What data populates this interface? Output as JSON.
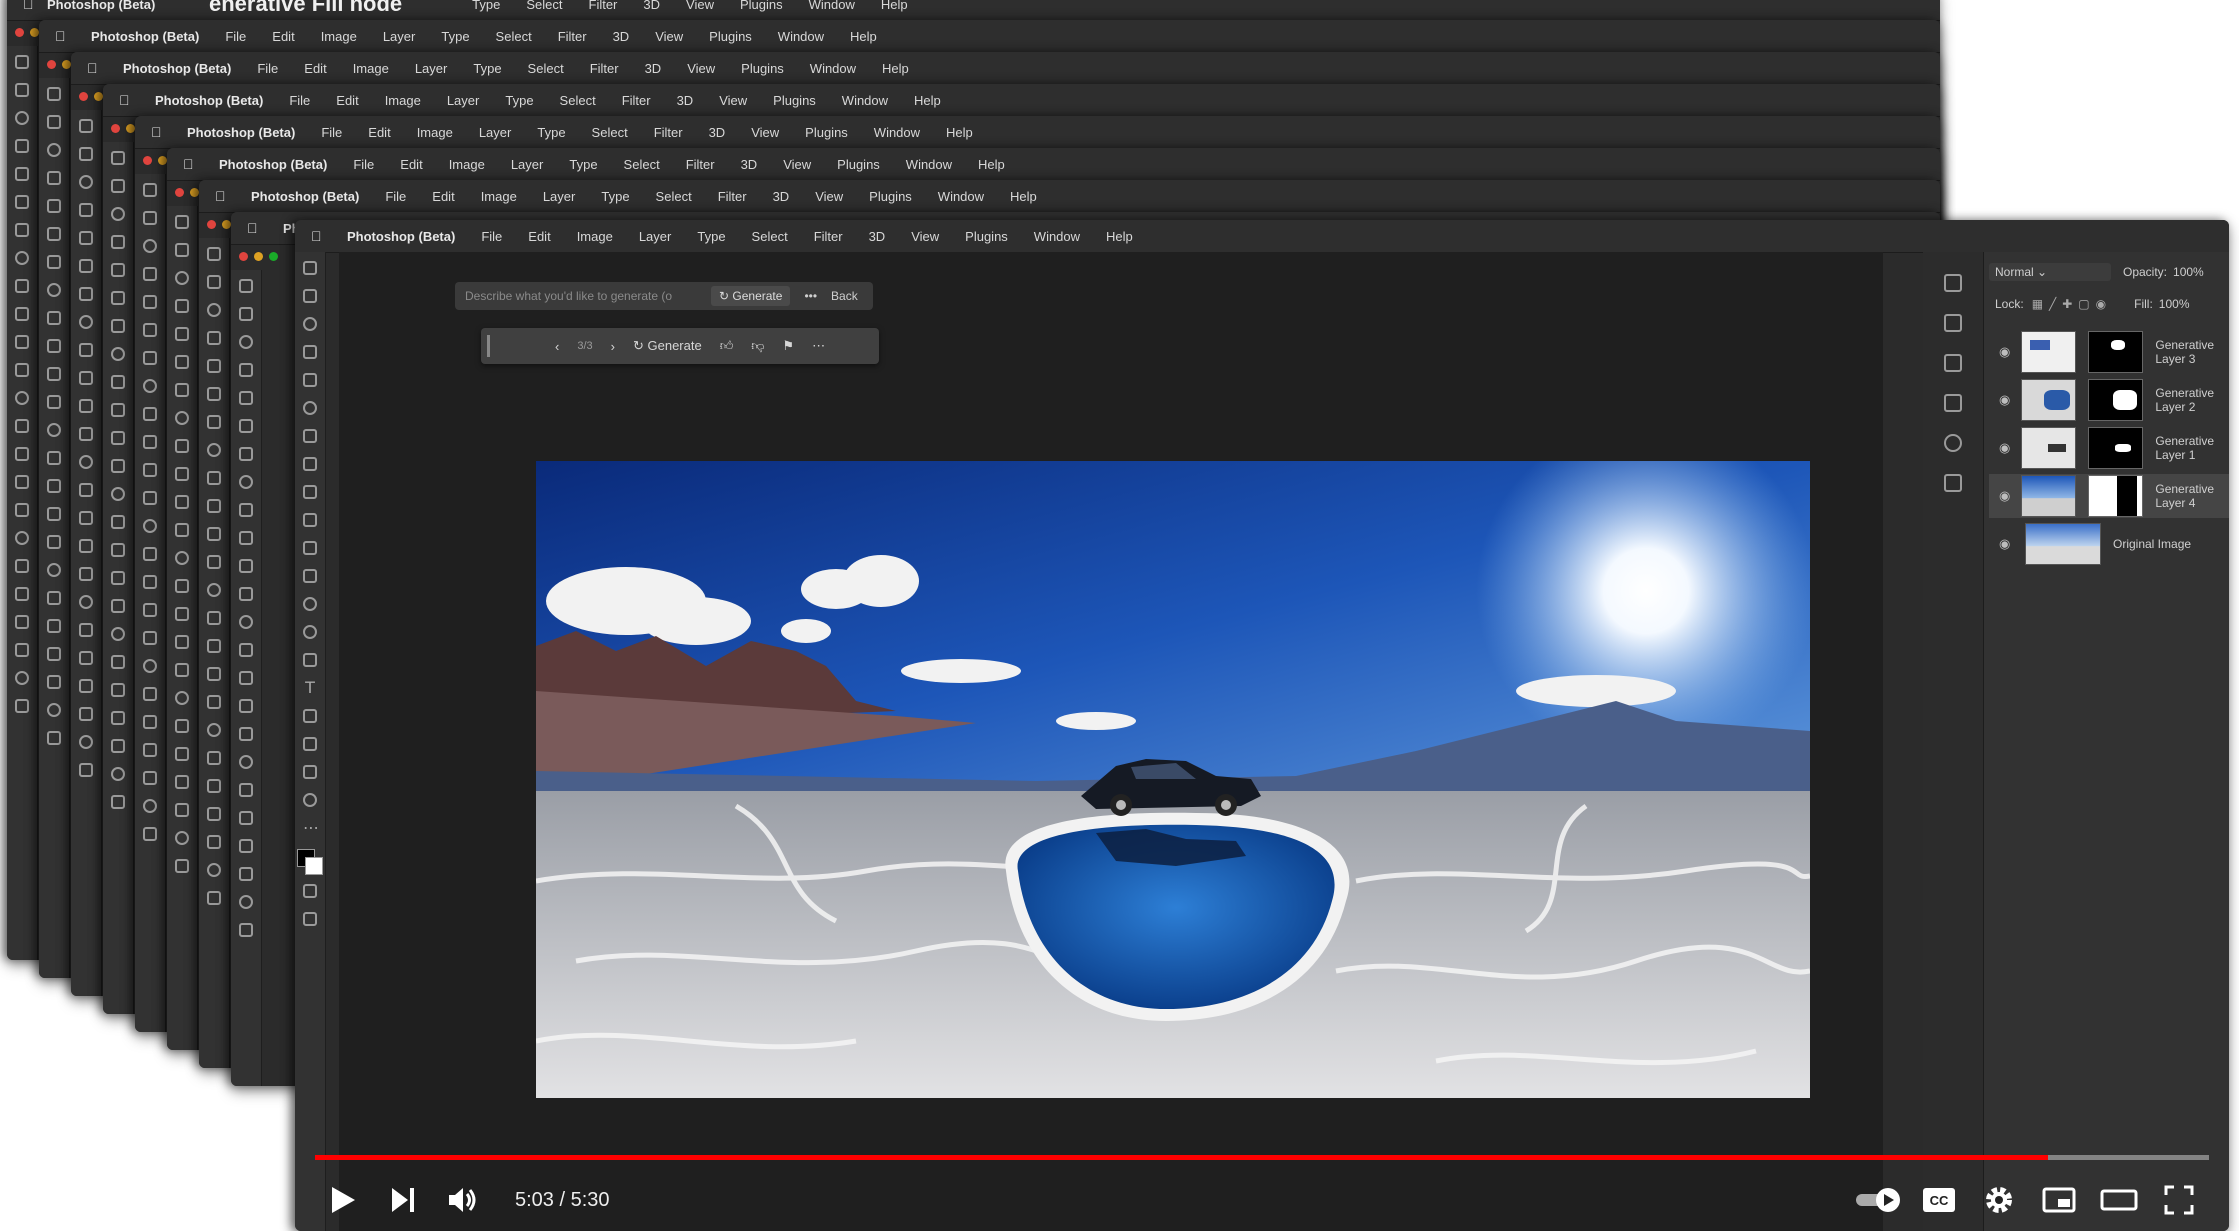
{
  "menubar": {
    "app": "Photoshop (Beta)",
    "items": [
      "File",
      "Edit",
      "Image",
      "Layer",
      "Type",
      "Select",
      "Filter",
      "3D",
      "View",
      "Plugins",
      "Window",
      "Help"
    ],
    "top_partial_items": [
      "Type",
      "Select",
      "Filter",
      "3D",
      "View",
      "Plugins",
      "Window",
      "Help"
    ]
  },
  "overlay_title": "enerative Fill node",
  "options_bar": {
    "placeholder": "Describe what you'd like to generate (o",
    "generate_label": "Generate",
    "more_label": "•••",
    "back_label": "Back"
  },
  "gen_toolbar": {
    "variation": "3/3",
    "generate_label": "Generate"
  },
  "panel": {
    "blend_mode": "Normal",
    "opacity_label": "Opacity:",
    "opacity_value": "100%",
    "lock_label": "Lock:",
    "fill_label": "Fill:",
    "fill_value": "100%"
  },
  "layers": [
    {
      "name": "Generative Layer 3"
    },
    {
      "name": "Generative Layer 2"
    },
    {
      "name": "Generative Layer 1"
    },
    {
      "name": "Generative Layer 4"
    },
    {
      "name": "Original Image"
    }
  ],
  "player": {
    "time": "5:03 / 5:30",
    "progress": 0.915,
    "accent": "#ff0000"
  },
  "colors": {
    "ps_bg": "#2b2b2b",
    "canvas_bg": "#1f1f1f",
    "menubar": "#2e2e2e"
  }
}
